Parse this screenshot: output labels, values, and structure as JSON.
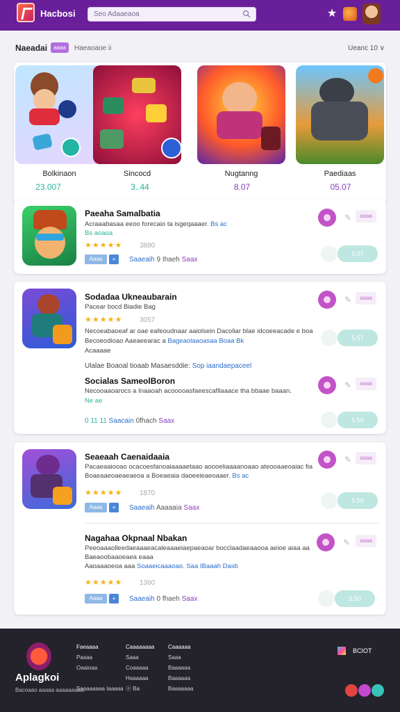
{
  "header": {
    "brand": "Hacbosi",
    "search_placeholder": "Seo Adaaeaoa",
    "icons": [
      "search-icon",
      "star-icon",
      "puzzle-icon",
      "avatar"
    ]
  },
  "section": {
    "title": "Naeadai",
    "tag": "aaaa",
    "subtitle": "Haeaoaoe ii",
    "right": "Ueanc 10 ∨"
  },
  "featured": [
    {
      "name": "Bolkinaon",
      "price": "23.007",
      "price_color": "#2bb39a"
    },
    {
      "name": "Sincocd",
      "price": "3..44",
      "price_color": "#2bb39a"
    },
    {
      "name": "Nugtanng",
      "price": "8.07",
      "price_color": "#8a3dbd"
    },
    {
      "name": "Paediaas",
      "price": "05.07",
      "price_color": "#8a3dbd"
    }
  ],
  "rows": [
    {
      "title": "Paeaha Samalbatia",
      "desc1": "Acraaabasaa eeoo forecaio ta isgeqaaaer.",
      "desc1_accent": "Bs ac",
      "desc2": "Bs aoaoa",
      "stars": "★★★★★",
      "rating": "3880",
      "chip": "Aaaa",
      "meta_a": "Saaeaih",
      "meta_b": "9 Ihaeh",
      "meta_c": "Saax",
      "pill": "aaaa",
      "play": "5.07"
    },
    {
      "title": "Sodadaa Ukneaubarain",
      "subtitle": "Pacear bocd Biadie Bag",
      "stars": "★★★★★",
      "rating": "3057",
      "desc1": "Necoeabaoeaf ar oae eafeoudnaar aaiolsein Dacoliar blae idcoeeacade e boa",
      "desc2_pre": "Becoeodioao Aaeaeearac a",
      "desc2_accent": "Bageaolaaoasaa Boaa Bk",
      "desc3": "Acaaaae",
      "pill": "aaaa",
      "play": "5.57"
    },
    {
      "title": "Socialas SameolBoron",
      "headline_pre": "Ulalae Boaoal tioaab Masaesddie:",
      "headline_accent": "Sop iaandaepaceel",
      "desc1": "Necooaaoarocs a Inaaoah acooooasfaeescafllaaace tha bbaae baaan.",
      "desc2": "Ne ae",
      "meta_pre": "0 11 11",
      "meta_a": "Saacain",
      "meta_b": "0fhach",
      "meta_c": "Saax",
      "pill": "aaaa",
      "play": "5.50"
    },
    {
      "title": "Seaeaah Caenaidaaia",
      "desc1": "Pacaeaaiooao ocacoesfanoaiaaaaetaao aoooeliaaaanoaao ateooaaeoaiac fia",
      "desc2": "Boaeaaeoaeaeaeoa a Boeaeaia daoeeieaeoaaer.",
      "desc2_accent": "Bs ac",
      "stars": "★★★★★",
      "rating": "1870",
      "chip": "Aaaa",
      "meta_a": "Saaeaih",
      "meta_b": "Aaaaaia",
      "meta_c": "Saax",
      "pill": "aaaa",
      "play": "5.50"
    },
    {
      "title": "Nagahaa Okpnaal Nbakan",
      "desc1": "Peeoaaaolleedaeaaaeacaleaaaeiaepaeaoar bocclaadaeaaooa aeioe aiaa aa",
      "desc2": "Baeaoobaaoeaea eaaa",
      "desc3_pre": "Aaoaaaoeoa aaa",
      "desc3_accent": "Soaaeicaaaoao. Saa IBaaah Dasb",
      "stars": "★★★★★",
      "rating": "1360",
      "chip": "Aaaa",
      "meta_a": "Saaeaih",
      "meta_b": "0 fhaeh",
      "meta_c": "Saax",
      "pill": "aaaa",
      "play": "5.50"
    }
  ],
  "footer": {
    "brand": "Aplagkoi",
    "tagline": "Bacoaao aaaaa aaaaaaaaa.",
    "col1": [
      "Faeaaaa",
      "Paaaa",
      "Oaaioaa",
      "Saaaaaaaa Iaaaaa"
    ],
    "col2": [
      "Caaaaaaaa",
      "Saaa",
      "Coaaaaa",
      "Haaaaaa",
      "ⓞ Ba"
    ],
    "col3": [
      "Caaaaaa",
      "Saaa",
      "Baaaaaa",
      "Baaaaaa",
      "Baaaaaaa"
    ],
    "badge_text": "BCIOT",
    "social_colors": [
      "#e0453f",
      "#c04ad0",
      "#38c3b7"
    ]
  }
}
